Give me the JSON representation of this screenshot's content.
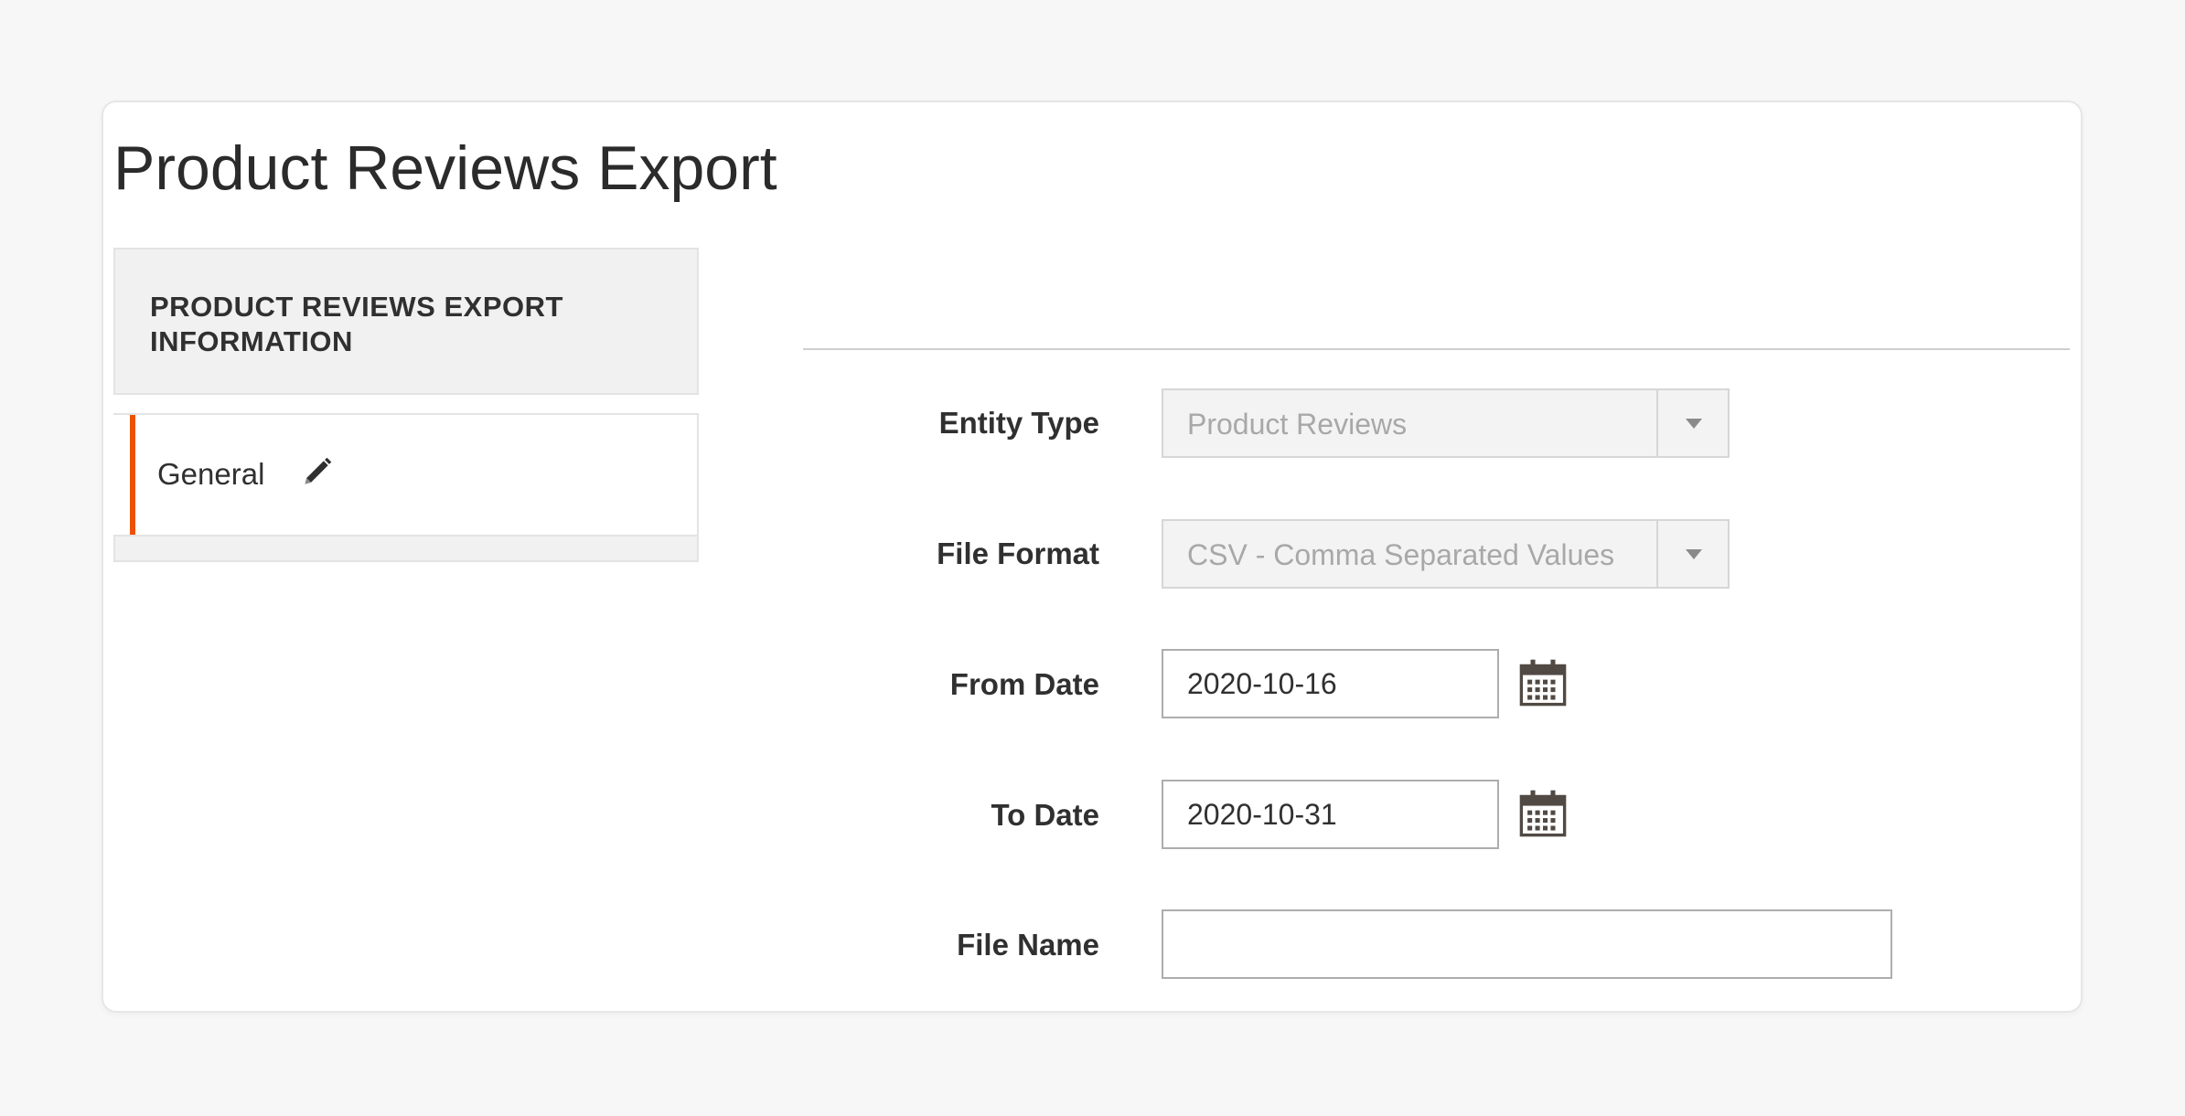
{
  "page": {
    "title": "Product Reviews Export"
  },
  "sidebar": {
    "header": "PRODUCT REVIEWS EXPORT INFORMATION",
    "items": [
      {
        "label": "General",
        "icon": "pencil-icon",
        "active": true
      }
    ],
    "accent_color": "#eb5202"
  },
  "form": {
    "entity_type": {
      "label": "Entity Type",
      "value": "Product Reviews"
    },
    "file_format": {
      "label": "File Format",
      "value": "CSV - Comma Separated Values"
    },
    "from_date": {
      "label": "From Date",
      "value": "2020-10-16",
      "icon": "calendar-icon"
    },
    "to_date": {
      "label": "To Date",
      "value": "2020-10-31",
      "icon": "calendar-icon"
    },
    "file_name": {
      "label": "File Name",
      "value": ""
    }
  }
}
